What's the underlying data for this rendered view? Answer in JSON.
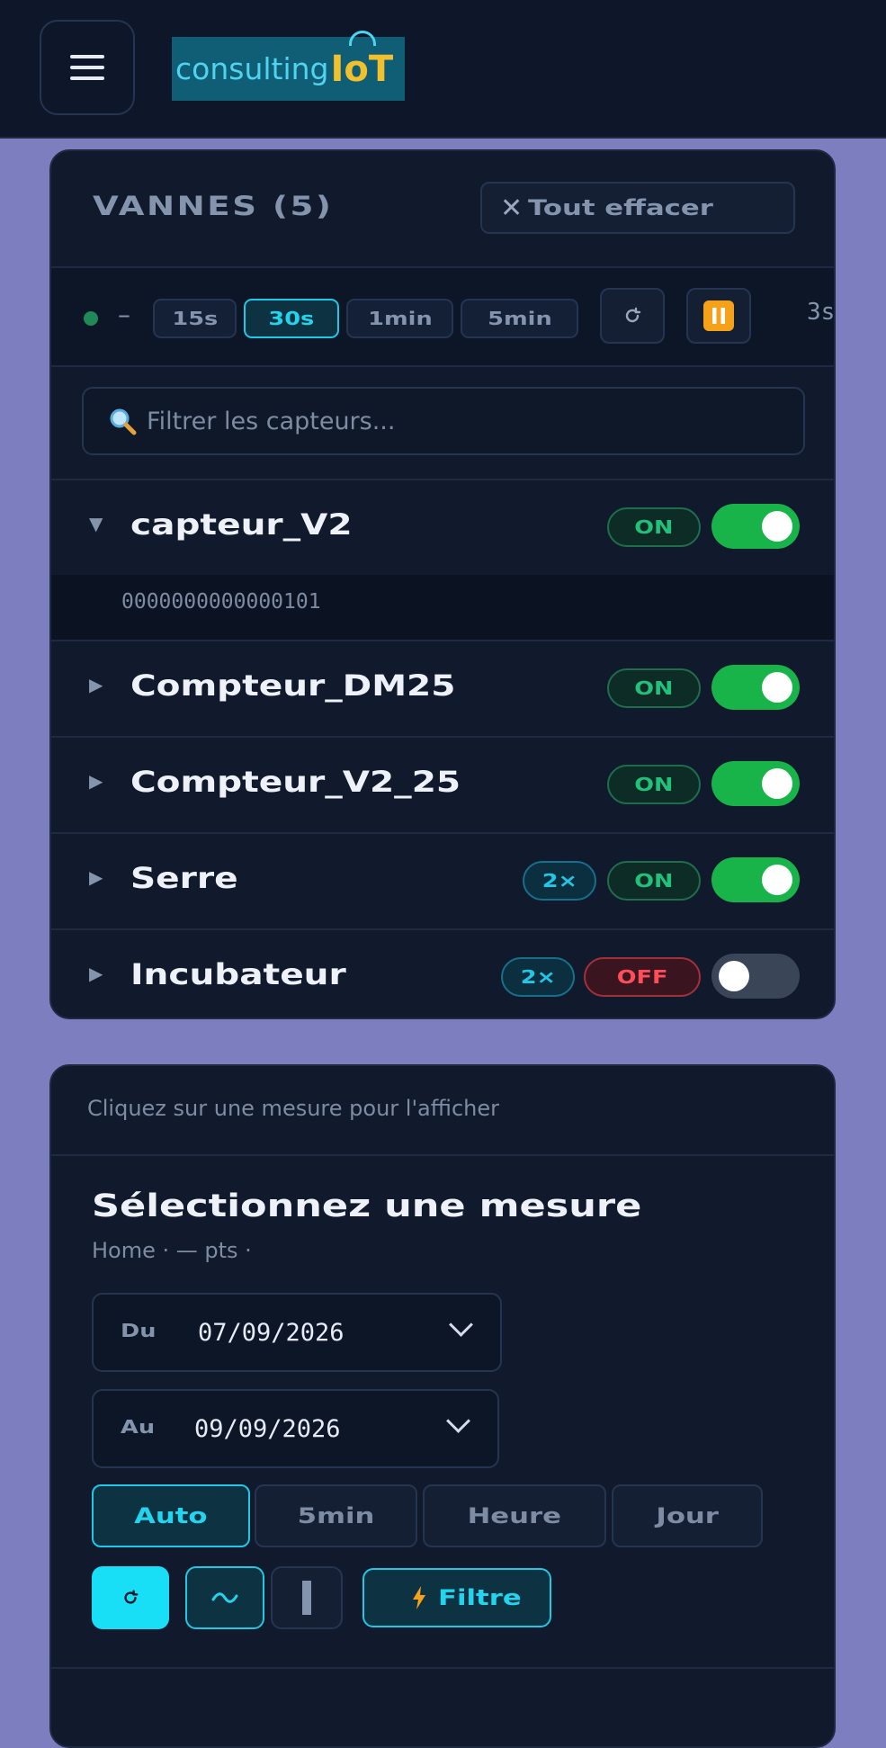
{
  "header": {
    "logo_text_1": "consulting",
    "logo_text_2": "IoT"
  },
  "vannes": {
    "title": "VANNES (5)",
    "clear_label": "Tout effacer",
    "refresh": {
      "status": "–",
      "intervals": [
        "15s",
        "30s",
        "1min",
        "5min"
      ],
      "active_interval": "30s",
      "countdown": "3s"
    },
    "search_placeholder": "Filtrer les capteurs...",
    "sensors": [
      {
        "name": "capteur_V2",
        "status": "ON",
        "expanded": true,
        "detail": "0000000000000101",
        "multiplier": null
      },
      {
        "name": "Compteur_DM25",
        "status": "ON",
        "expanded": false,
        "multiplier": null
      },
      {
        "name": "Compteur_V2_25",
        "status": "ON",
        "expanded": false,
        "multiplier": null
      },
      {
        "name": "Serre",
        "status": "ON",
        "expanded": false,
        "multiplier": "2×"
      },
      {
        "name": "Incubateur",
        "status": "OFF",
        "expanded": false,
        "multiplier": "2×"
      }
    ]
  },
  "measure": {
    "hint": "Cliquez sur une mesure pour l'afficher",
    "title": "Sélectionnez une mesure",
    "subtitle": "Home · — pts ·",
    "from_label": "Du",
    "from_value": "07/09/2026",
    "to_label": "Au",
    "to_value": "09/09/2026",
    "aggregations": [
      "Auto",
      "5min",
      "Heure",
      "Jour"
    ],
    "active_aggregation": "Auto",
    "filter_label": "Filtre"
  },
  "colors": {
    "accent": "#22d4ee",
    "on": "#22c07a",
    "off": "#ff4d59",
    "toggle_on": "#19b449"
  }
}
